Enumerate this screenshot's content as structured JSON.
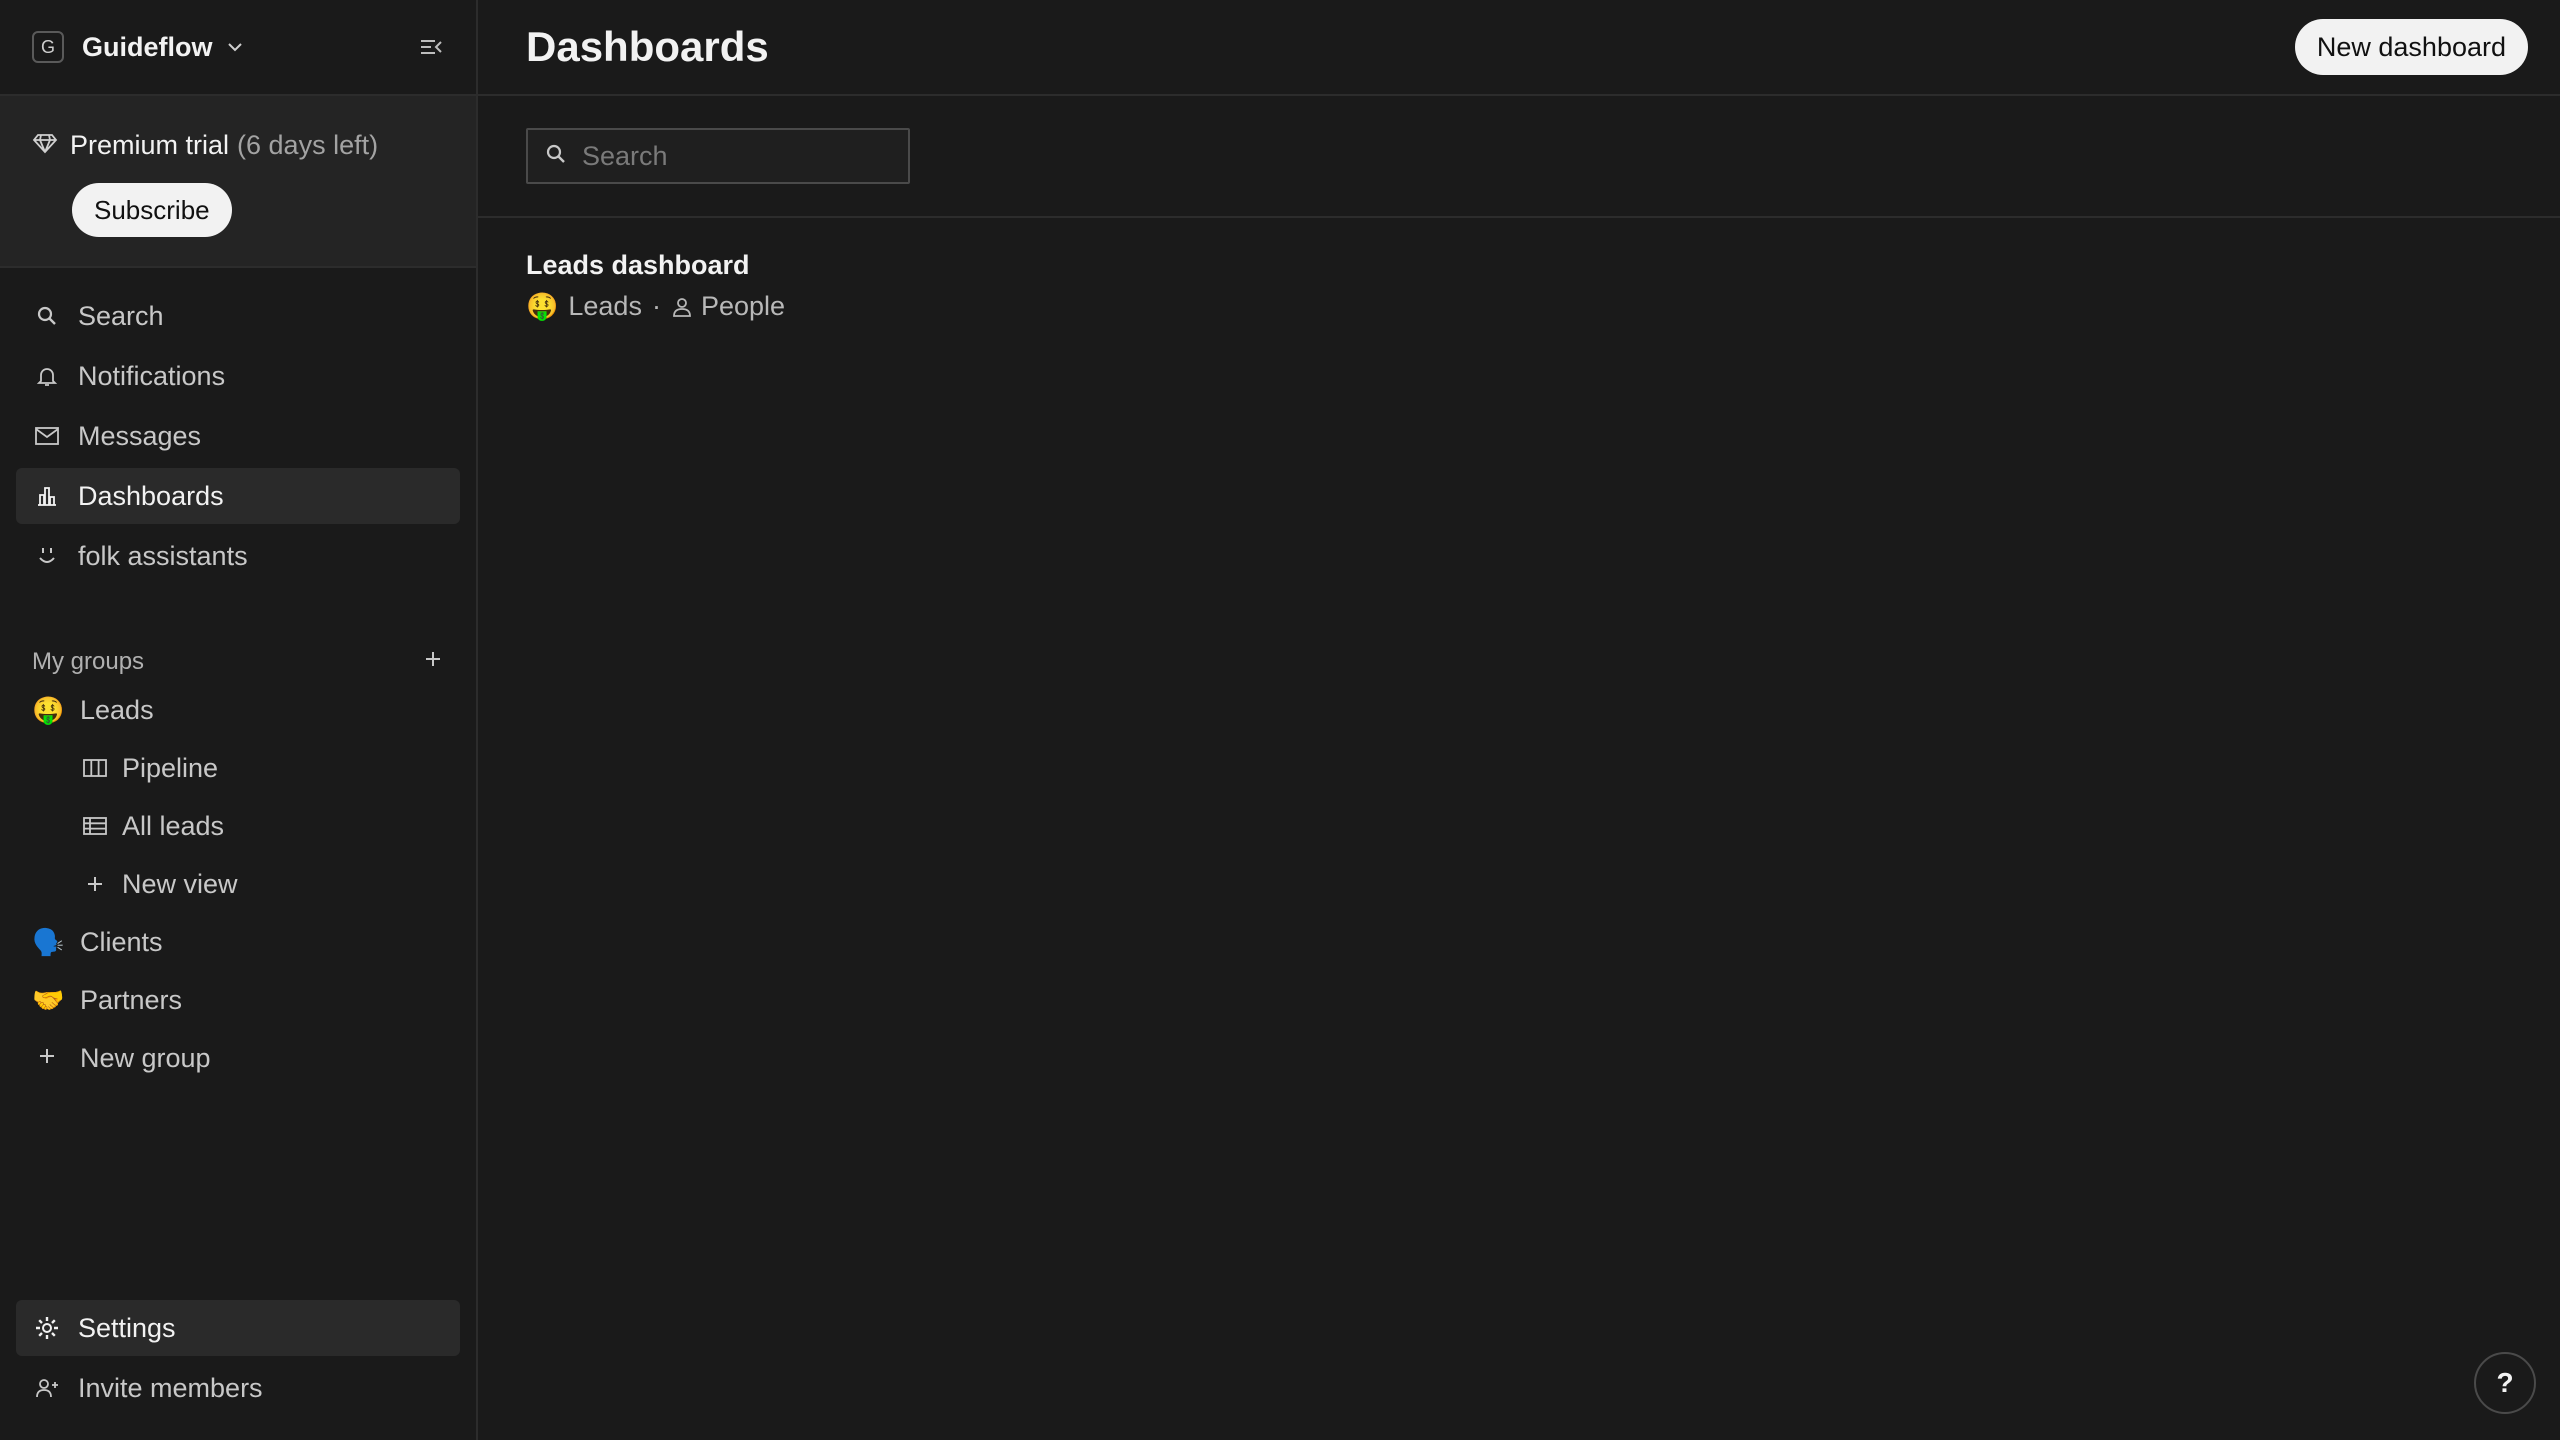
{
  "workspace": {
    "logo_letter": "G",
    "name": "Guideflow"
  },
  "trial": {
    "title": "Premium trial",
    "days_left": "(6 days left)",
    "subscribe_label": "Subscribe"
  },
  "nav": {
    "items": [
      {
        "label": "Search",
        "icon": "search-icon"
      },
      {
        "label": "Notifications",
        "icon": "bell-icon"
      },
      {
        "label": "Messages",
        "icon": "mail-icon"
      },
      {
        "label": "Dashboards",
        "icon": "bar-chart-icon",
        "active": true
      },
      {
        "label": "folk assistants",
        "icon": "assistant-icon"
      }
    ]
  },
  "groups": {
    "header": "My groups",
    "items": [
      {
        "emoji": "🤑",
        "label": "Leads"
      },
      {
        "emoji": "🗣️",
        "label": "Clients"
      },
      {
        "emoji": "🤝",
        "label": "Partners"
      }
    ],
    "lead_views": [
      {
        "label": "Pipeline",
        "icon": "kanban-icon"
      },
      {
        "label": "All leads",
        "icon": "table-icon"
      },
      {
        "label": "New view",
        "icon": "plus-icon"
      }
    ],
    "new_group_label": "New group"
  },
  "bottom_nav": {
    "settings_label": "Settings",
    "invite_label": "Invite members"
  },
  "main": {
    "title": "Dashboards",
    "new_dashboard_label": "New dashboard",
    "search_placeholder": "Search",
    "dashboards": [
      {
        "title": "Leads dashboard",
        "group_emoji": "🤑",
        "group": "Leads",
        "separator": "·",
        "entity": "People"
      }
    ],
    "help_label": "?"
  },
  "colors": {
    "background": "#1a1a1a",
    "panel": "#242424",
    "active_item": "#2a2a2a",
    "border": "#2c2c2c",
    "button": "#f2f2f2"
  }
}
